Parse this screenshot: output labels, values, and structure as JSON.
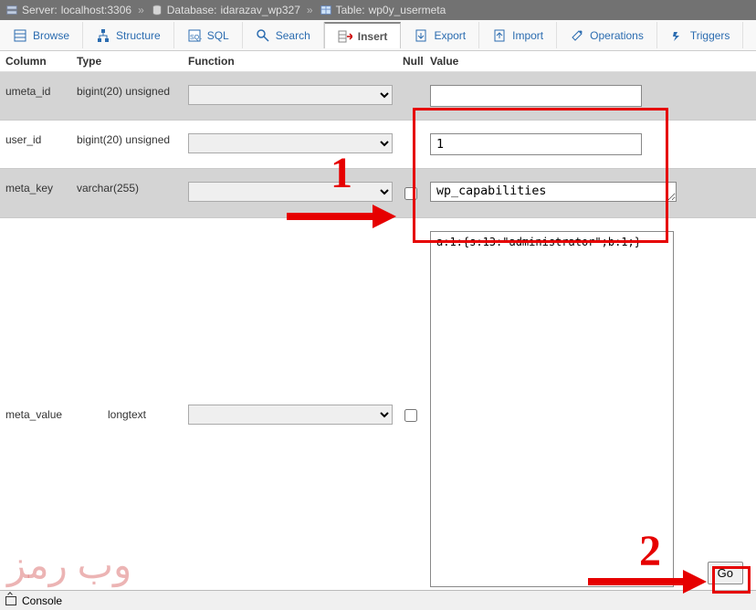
{
  "breadcrumb": {
    "server_label": "Server:",
    "server_value": "localhost:3306",
    "db_label": "Database:",
    "db_value": "idarazav_wp327",
    "table_label": "Table:",
    "table_value": "wp0y_usermeta"
  },
  "tabs": {
    "browse": "Browse",
    "structure": "Structure",
    "sql": "SQL",
    "search": "Search",
    "insert": "Insert",
    "export": "Export",
    "import": "Import",
    "operations": "Operations",
    "triggers": "Triggers"
  },
  "headers": {
    "column": "Column",
    "type": "Type",
    "function": "Function",
    "null": "Null",
    "value": "Value"
  },
  "rows": {
    "umeta_id": {
      "name": "umeta_id",
      "type": "bigint(20) unsigned",
      "value": ""
    },
    "user_id": {
      "name": "user_id",
      "type": "bigint(20) unsigned",
      "value": "1"
    },
    "meta_key": {
      "name": "meta_key",
      "type": "varchar(255)",
      "value": "wp_capabilities"
    },
    "meta_value": {
      "name": "meta_value",
      "type": "longtext",
      "value": "a:1:{s:13:\"administrator\";b:1;}"
    }
  },
  "buttons": {
    "go": "Go"
  },
  "console": {
    "label": "Console"
  },
  "watermark": "وب رمز"
}
